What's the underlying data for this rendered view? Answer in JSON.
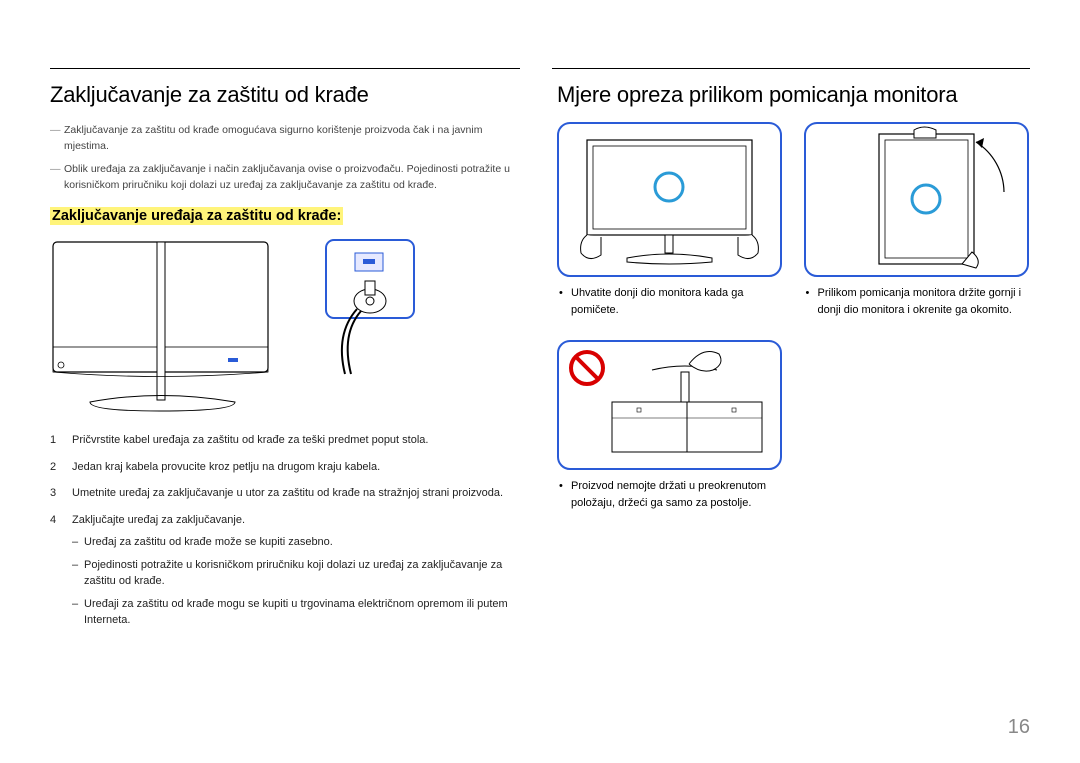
{
  "page_number": "16",
  "left": {
    "heading": "Zaključavanje za zaštitu od krađe",
    "notes": [
      "Zaključavanje za zaštitu od krađe omogućava sigurno korištenje proizvoda čak i na javnim mjestima.",
      "Oblik uređaja za zaključavanje i način zaključavanja ovise o proizvođaču. Pojedinosti potražite u korisničkom priručniku koji dolazi uz uređaj za zaključavanje za zaštitu od krađe."
    ],
    "subheading": "Zaključavanje uređaja za zaštitu od krađe:",
    "steps": [
      {
        "text": "Pričvrstite kabel uređaja za zaštitu od krađe za teški predmet poput stola."
      },
      {
        "text": "Jedan kraj kabela provucite kroz petlju na drugom kraju kabela."
      },
      {
        "text": "Umetnite uređaj za zaključavanje u utor za zaštitu od krađe na stražnjoj strani proizvoda."
      },
      {
        "text": "Zaključajte uređaj za zaključavanje.",
        "sub": [
          "Uređaj za zaštitu od krađe može se kupiti zasebno.",
          "Pojedinosti potražite u korisničkom priručniku koji dolazi uz uređaj za zaključavanje za zaštitu od krađe.",
          "Uređaji za zaštitu od krađe mogu se kupiti u trgovinama električnom opremom ili putem Interneta."
        ]
      }
    ]
  },
  "right": {
    "heading": "Mjere opreza prilikom pomicanja monitora",
    "captions": [
      "Uhvatite donji dio monitora kada ga pomičete.",
      "Prilikom pomicanja monitora držite gornji i donji dio monitora i okrenite ga okomito."
    ],
    "caption2": "Proizvod nemojte držati u preokrenutom položaju, držeći ga samo za postolje."
  }
}
